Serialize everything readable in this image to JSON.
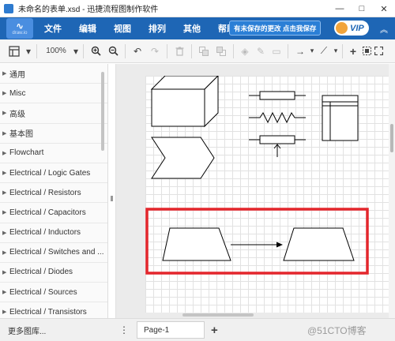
{
  "window": {
    "title": "未命名的表单.xsd - 迅捷流程图制作软件",
    "minimize": "—",
    "maximize": "□",
    "close": "✕"
  },
  "menubar": {
    "logo_sub": "draw.io",
    "items": [
      "文件",
      "编辑",
      "视图",
      "排列",
      "其他",
      "帮助"
    ],
    "save_notice": "有未保存的更改 点击我保存",
    "vip_label": "VIP",
    "collapse_icon": "chevron-up-icon"
  },
  "toolbar": {
    "zoom": "100%"
  },
  "sidebar": {
    "items": [
      {
        "label": "通用"
      },
      {
        "label": "Misc"
      },
      {
        "label": "高级"
      },
      {
        "label": "基本图"
      },
      {
        "label": "Flowchart"
      },
      {
        "label": "Electrical / Logic Gates"
      },
      {
        "label": "Electrical / Resistors"
      },
      {
        "label": "Electrical / Capacitors"
      },
      {
        "label": "Electrical / Inductors"
      },
      {
        "label": "Electrical / Switches and ..."
      },
      {
        "label": "Electrical / Diodes"
      },
      {
        "label": "Electrical / Sources"
      },
      {
        "label": "Electrical / Transistors"
      }
    ],
    "more_libraries": "更多图库..."
  },
  "bottom": {
    "page_tab": "Page-1",
    "add_page": "+",
    "page_menu": "⋮",
    "watermark": "@51CTO博客"
  },
  "colors": {
    "menubar": "#1e66b5",
    "highlight_box": "#e3262c"
  }
}
